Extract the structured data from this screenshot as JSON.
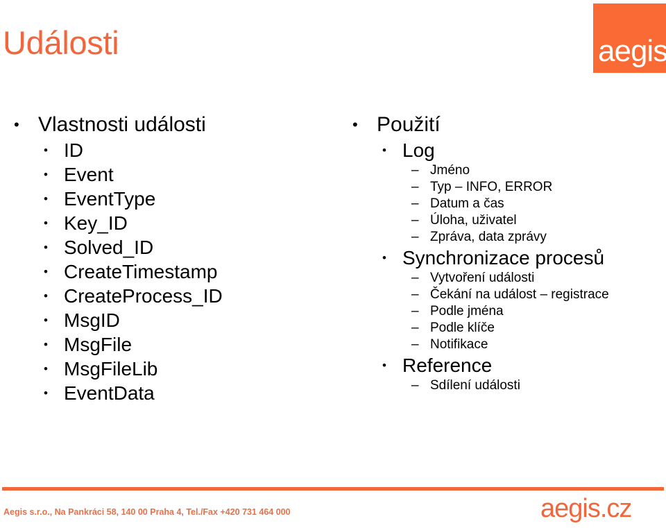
{
  "slide": {
    "title": "Události",
    "accent_color": "#F2663C",
    "logo_color": "#F96A35",
    "bullet_level1": "•",
    "bullet_level2": "•",
    "bullet_level3": "–"
  },
  "logo": {
    "wordmark": "aegis"
  },
  "left_column": {
    "heading": "Vlastnosti události",
    "items": [
      "ID",
      "Event",
      "EventType",
      "Key_ID",
      "Solved_ID",
      "CreateTimestamp",
      "CreateProcess_ID",
      "MsgID",
      "MsgFile",
      "MsgFileLib",
      "EventData"
    ]
  },
  "right_column": {
    "heading": "Použití",
    "groups": [
      {
        "label": "Log",
        "items": [
          "Jméno",
          "Typ – INFO, ERROR",
          "Datum a čas",
          "Úloha, uživatel",
          "Zpráva, data zprávy"
        ]
      },
      {
        "label": "Synchronizace procesů",
        "items": [
          "Vytvoření události",
          "Čekání na událost – registrace",
          "Podle jména",
          "Podle klíče",
          "Notifikace"
        ]
      },
      {
        "label": "Reference",
        "items": [
          "Sdílení události"
        ]
      }
    ]
  },
  "footer": {
    "contact": "Aegis s.r.o., Na Pankráci 58, 140 00 Praha 4, Tel./Fax +420 731 464 000",
    "brand": "aegis.cz"
  }
}
